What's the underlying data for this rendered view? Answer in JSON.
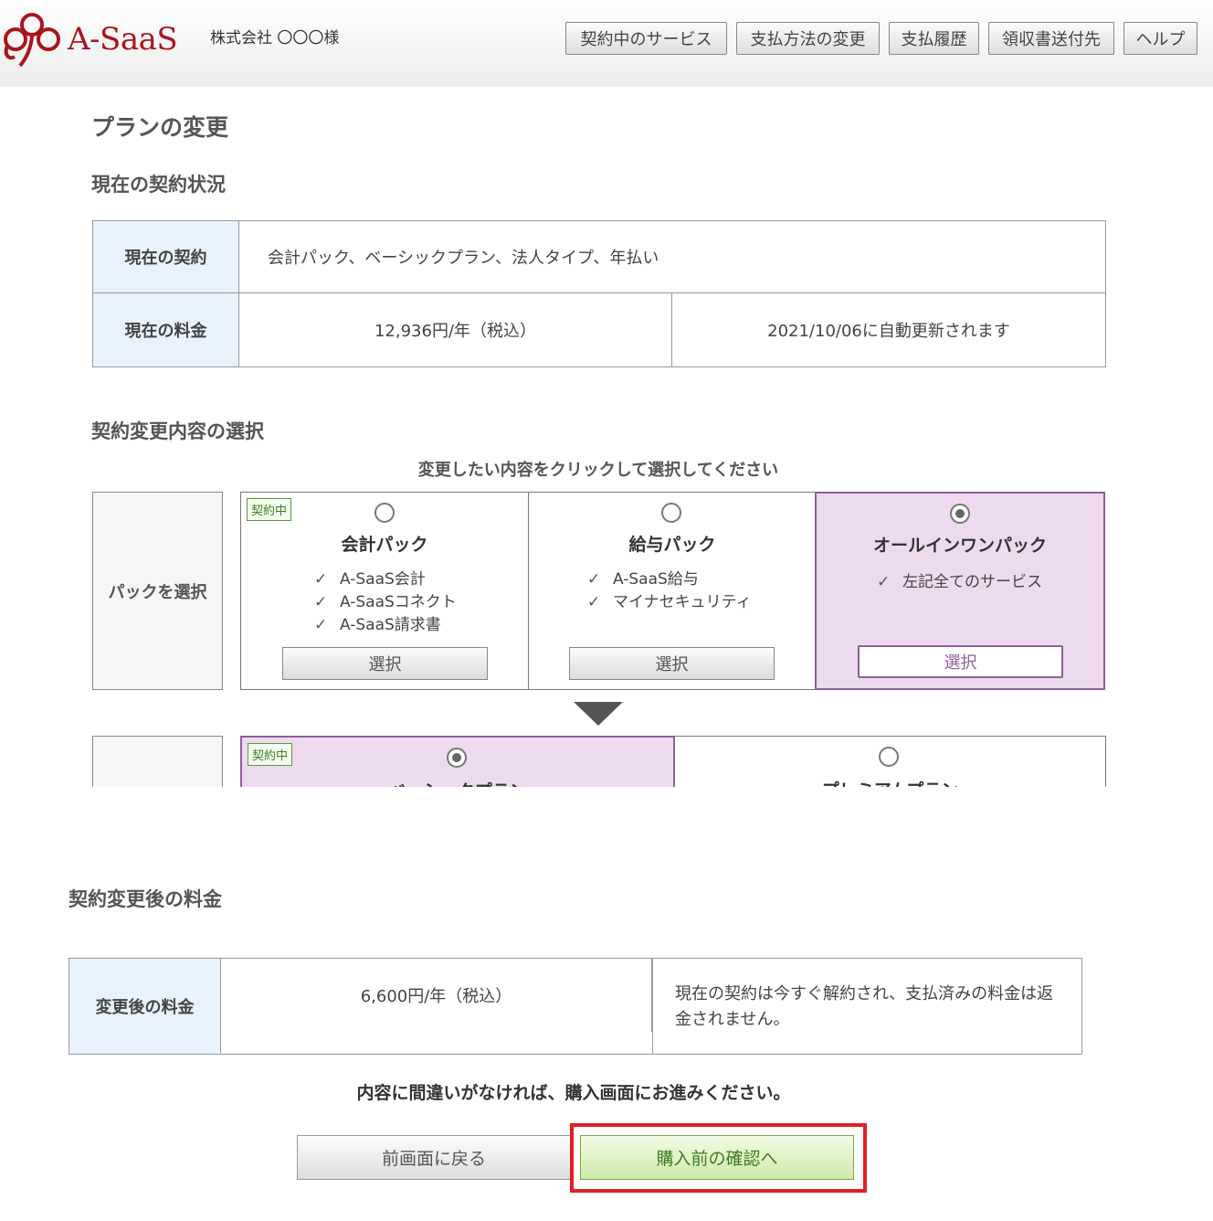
{
  "header": {
    "logo_text": "A-SaaS",
    "company": "株式会社 〇〇〇様",
    "nav": [
      {
        "label": "契約中のサービス"
      },
      {
        "label": "支払方法の変更"
      },
      {
        "label": "支払履歴"
      },
      {
        "label": "領収書送付先"
      },
      {
        "label": "ヘルプ"
      }
    ]
  },
  "page_title": "プランの変更",
  "current": {
    "heading": "現在の契約状況",
    "contract_label": "現在の契約",
    "contract_value": "会計パック、ベーシックプラン、法人タイプ、年払い",
    "fee_label": "現在の料金",
    "fee_value": "12,936円/年（税込）",
    "renewal": "2021/10/06に自動更新されます"
  },
  "selection": {
    "heading": "契約変更内容の選択",
    "instruction": "変更したい内容をクリックして選択してください",
    "pack_label": "パックを選択",
    "badge": "契約中",
    "select_label": "選択",
    "check": "✓",
    "packs": [
      {
        "title": "会計パック",
        "features": [
          "A-SaaS会計",
          "A-SaaSコネクト",
          "A-SaaS請求書"
        ],
        "selected": false
      },
      {
        "title": "給与パック",
        "features": [
          "A-SaaS給与",
          "マイナセキュリティ"
        ],
        "selected": false
      },
      {
        "title": "オールインワンパック",
        "features": [
          "左記全てのサービス"
        ],
        "selected": true
      }
    ],
    "plans": [
      {
        "title": "ベーシックプラン",
        "selected": true
      },
      {
        "title": "プレミアムプラン",
        "selected": false
      }
    ]
  },
  "after": {
    "heading": "契約変更後の料金",
    "fee_label": "変更後の料金",
    "fee_value": "6,600円/年（税込）",
    "warning": "現在の契約は今すぐ解約され、支払済みの料金は返金されません。"
  },
  "footer": {
    "message": "内容に間違いがなければ、購入画面にお進みください。",
    "back_label": "前画面に戻る",
    "next_label": "購入前の確認へ"
  }
}
